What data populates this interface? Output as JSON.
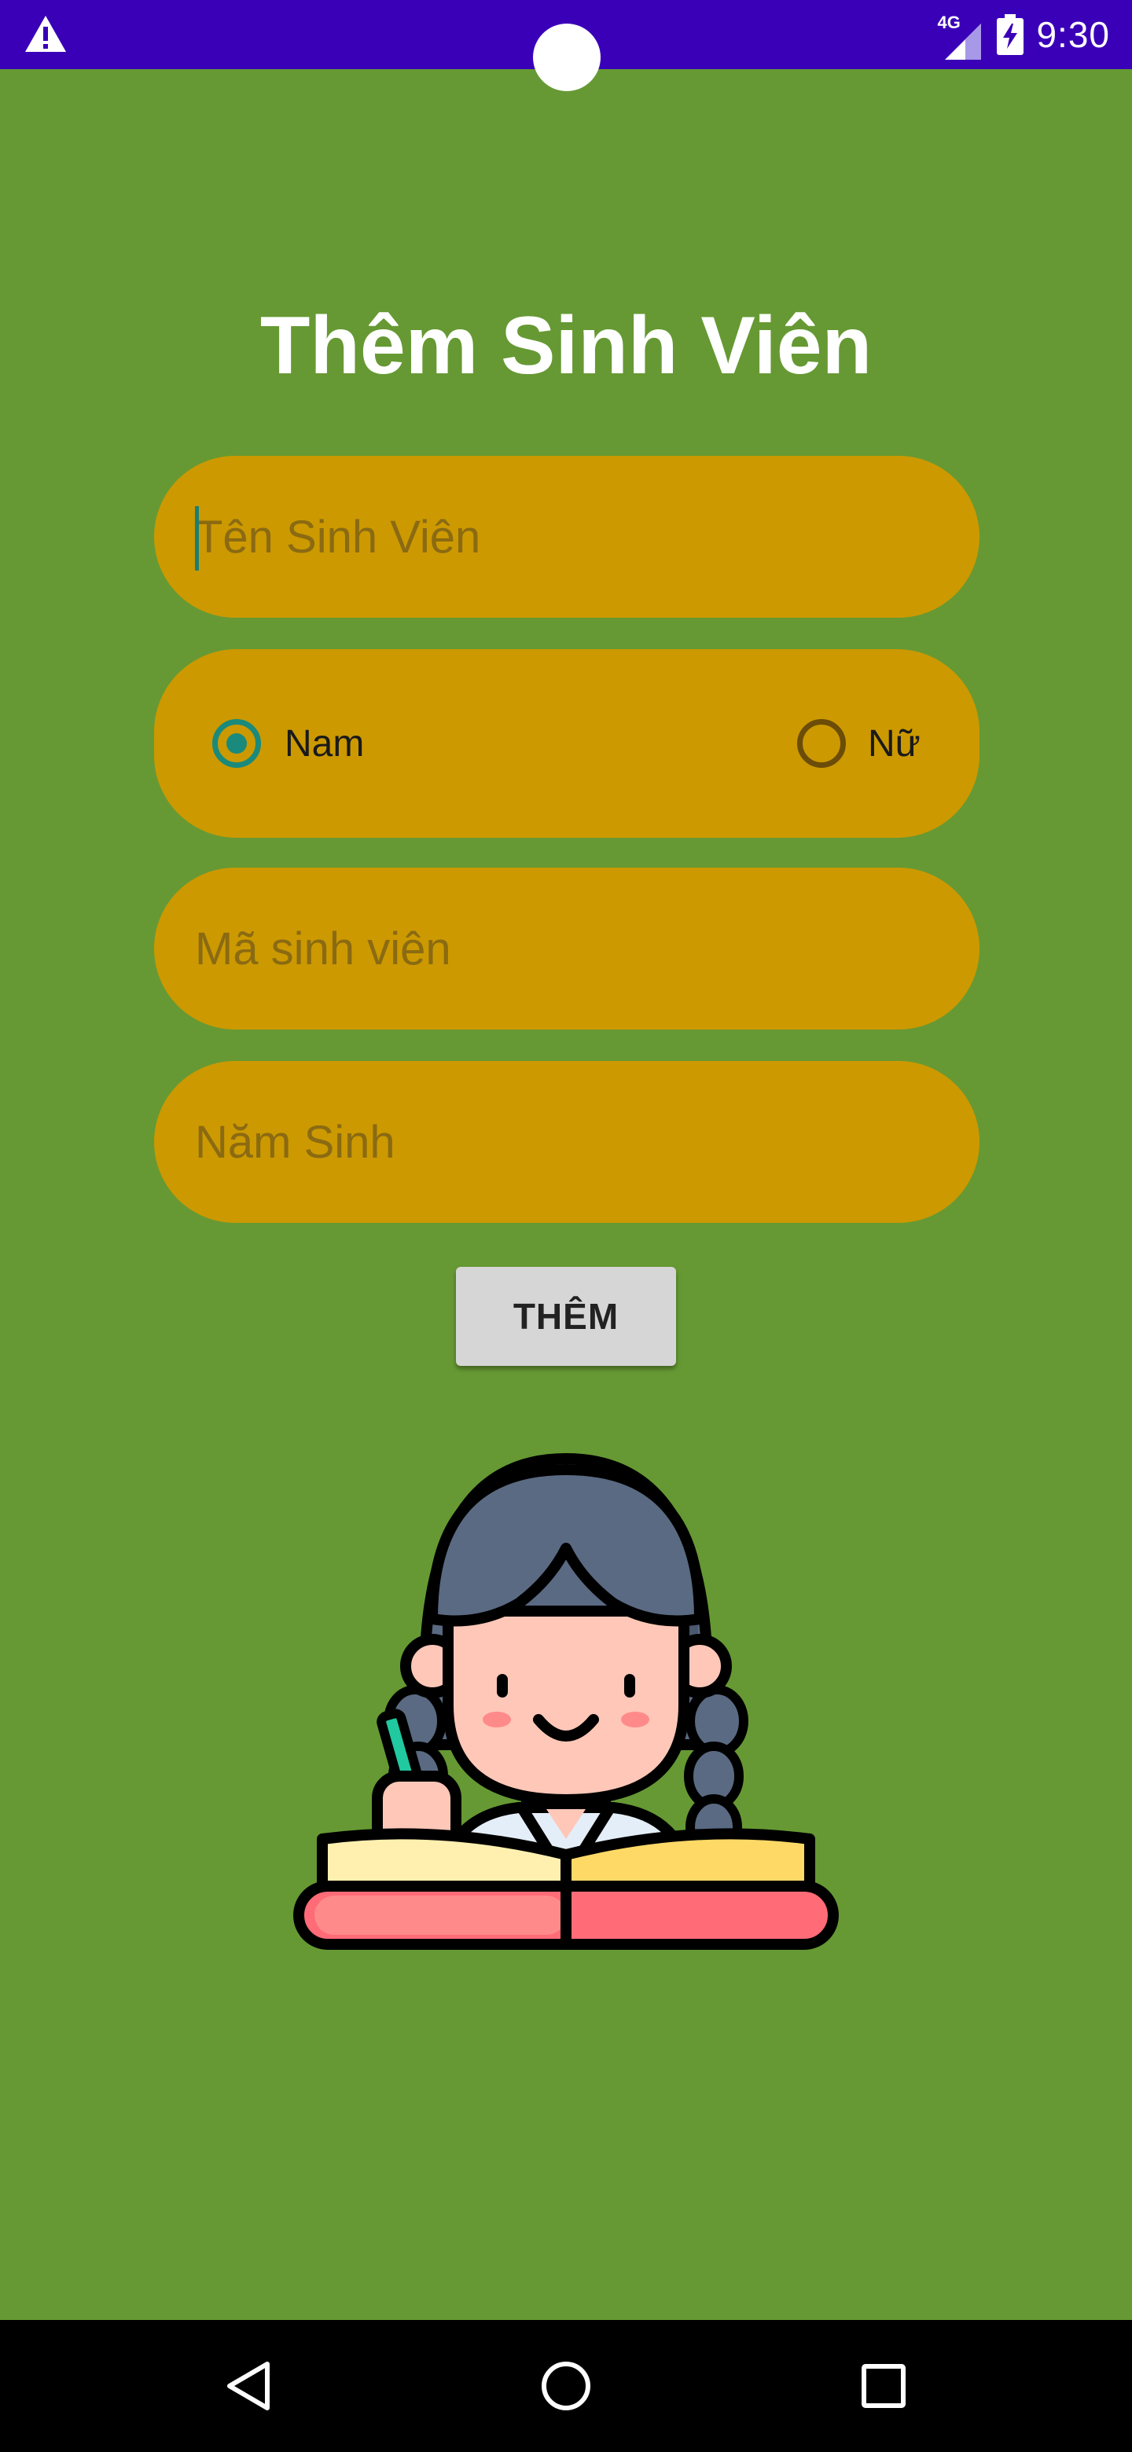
{
  "status_bar": {
    "network_type": "4G",
    "time": "9:30",
    "icons": [
      "warning-icon",
      "signal-icon",
      "battery-charging-icon"
    ],
    "background_color": "#3a00b8"
  },
  "form": {
    "title": "Thêm Sinh Viên",
    "name_field": {
      "placeholder": "Tên Sinh Viên",
      "value": ""
    },
    "gender": {
      "options": [
        {
          "label": "Nam",
          "checked": true
        },
        {
          "label": "Nữ",
          "checked": false
        }
      ]
    },
    "student_id_field": {
      "placeholder": "Mã sinh viên",
      "value": ""
    },
    "birth_year_field": {
      "placeholder": "Năm Sinh",
      "value": ""
    },
    "submit_label": "THÊM"
  },
  "illustration": {
    "icon": "student-reading-icon"
  },
  "nav_bar": {
    "buttons": [
      "back-icon",
      "home-icon",
      "recents-icon"
    ]
  },
  "colors": {
    "background": "#669933",
    "field_fill": "#cc9900",
    "radio_accent": "#1a8a7c",
    "button_fill": "#d6d6d6"
  }
}
